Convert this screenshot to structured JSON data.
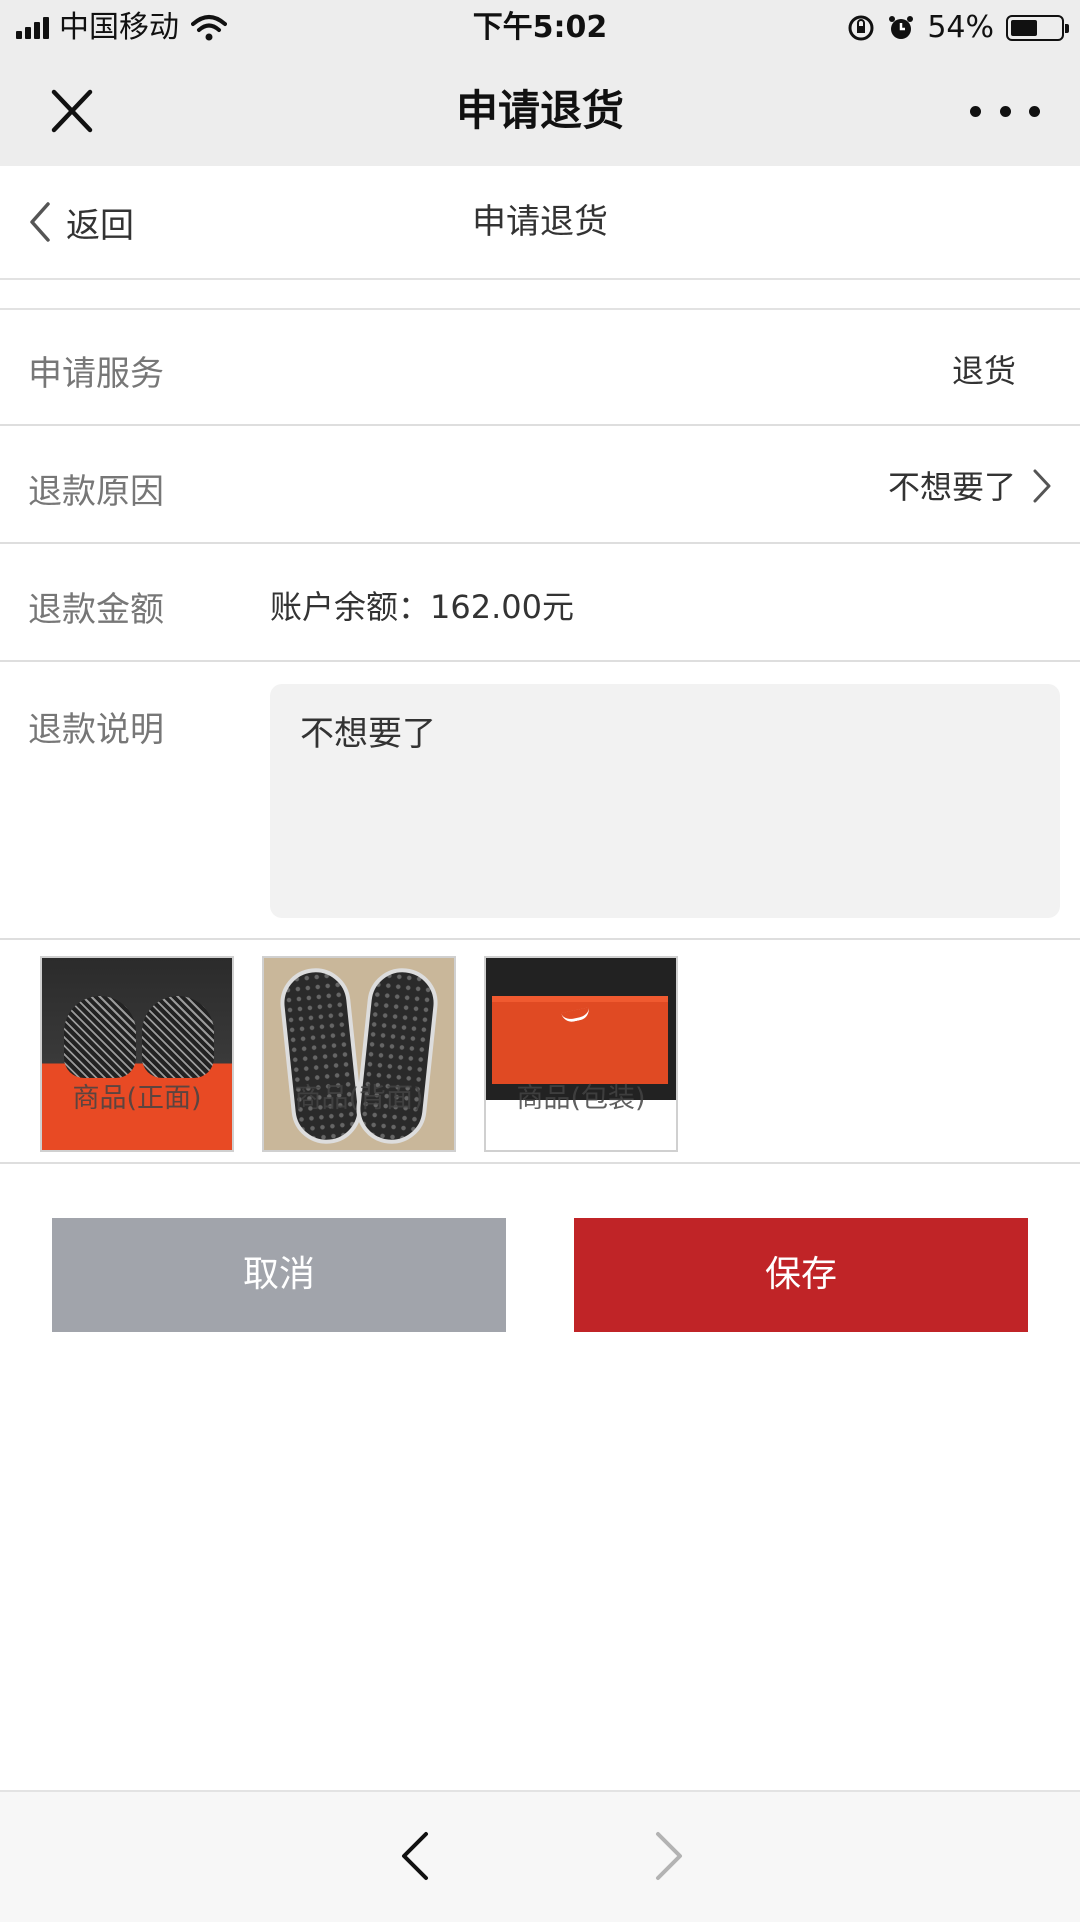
{
  "status_bar": {
    "carrier": "中国移动",
    "time": "下午5:02",
    "battery": "54%",
    "battery_level": 0.54
  },
  "nav_bar": {
    "title": "申请退货",
    "icons": [
      "close-icon",
      "more-icon"
    ]
  },
  "page_header": {
    "back_label": "返回",
    "title": "申请退货"
  },
  "form": {
    "service": {
      "label": "申请服务",
      "value": "退货"
    },
    "reason": {
      "label": "退款原因",
      "value": "不想要了"
    },
    "amount": {
      "label": "退款金额",
      "value": "账户余额：162.00元"
    },
    "description": {
      "label": "退款说明",
      "value": "不想要了"
    }
  },
  "photos": [
    {
      "caption": "商品(正面)"
    },
    {
      "caption": "商品(背面)"
    },
    {
      "caption": "商品(包装)"
    }
  ],
  "actions": {
    "cancel_label": "取消",
    "save_label": "保存"
  },
  "colors": {
    "primary": "#c02427",
    "secondary": "#a1a4ab"
  }
}
